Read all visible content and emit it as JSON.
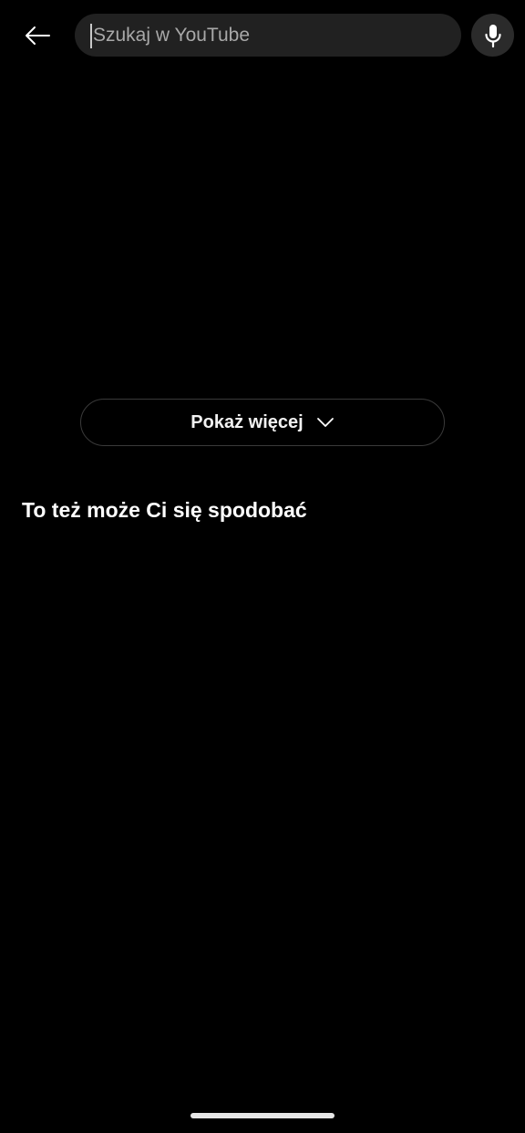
{
  "search": {
    "placeholder": "Szukaj w YouTube",
    "value": ""
  },
  "show_more": {
    "label": "Pokaż więcej"
  },
  "section": {
    "title": "To też może Ci się spodobać"
  },
  "icons": {
    "back": "arrow-left-icon",
    "mic": "microphone-icon",
    "chevron": "chevron-down-icon"
  },
  "colors": {
    "background": "#000000",
    "search_box": "#212121",
    "mic_button": "#2b2b2b",
    "text": "#ffffff",
    "placeholder": "#a8a8a8",
    "outline": "#3a3a3a"
  }
}
